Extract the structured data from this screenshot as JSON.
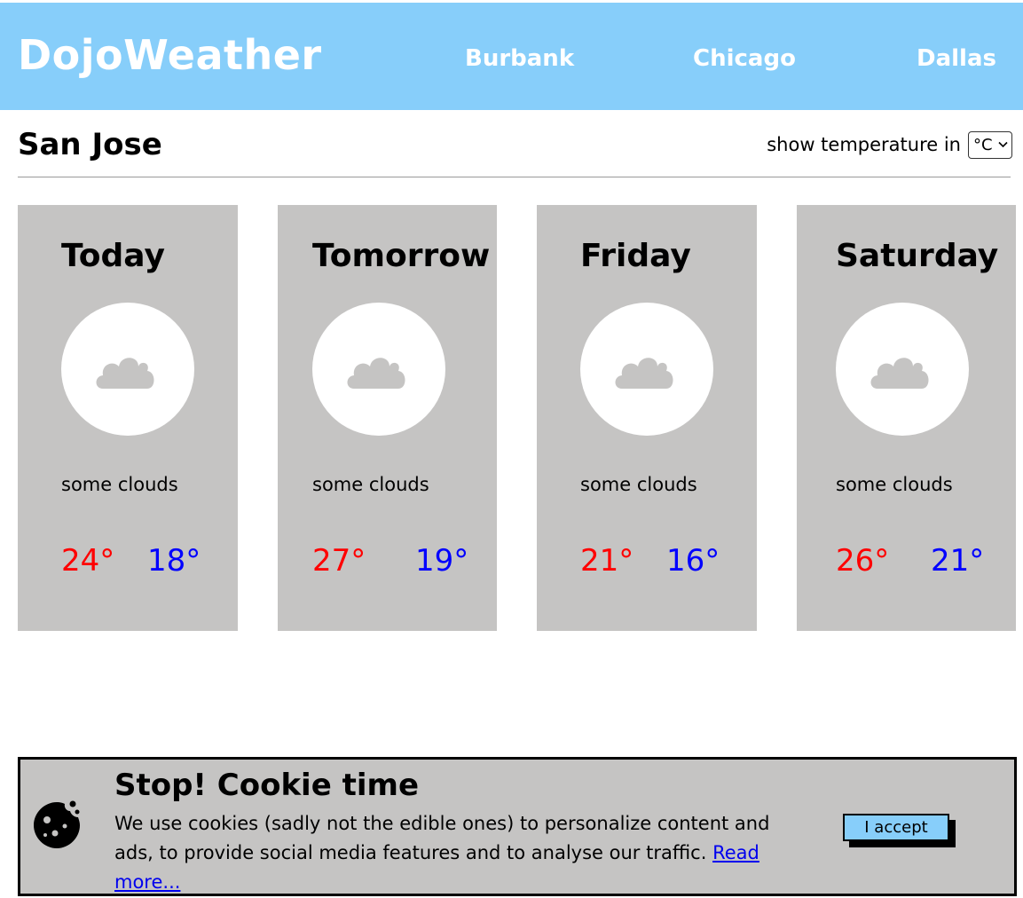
{
  "header": {
    "logo": "DojoWeather",
    "nav": [
      "Burbank",
      "Chicago",
      "Dallas"
    ],
    "background_color": "#87cefa"
  },
  "city": {
    "name": "San Jose",
    "unit_label": "show temperature in",
    "unit_selected": "°C"
  },
  "forecast": [
    {
      "day": "Today",
      "icon": "cloud-icon",
      "condition": "some clouds",
      "high": "24°",
      "low": "18°"
    },
    {
      "day": "Tomorrow",
      "icon": "cloud-icon",
      "condition": "some clouds",
      "high": "27°",
      "low": "19°"
    },
    {
      "day": "Friday",
      "icon": "cloud-icon",
      "condition": "some clouds",
      "high": "21°",
      "low": "16°"
    },
    {
      "day": "Saturday",
      "icon": "cloud-icon",
      "condition": "some clouds",
      "high": "26°",
      "low": "21°"
    }
  ],
  "colors": {
    "high_temp": "#ff0000",
    "low_temp": "#0000ff",
    "card_bg": "#c5c4c3"
  },
  "cookie": {
    "icon": "cookie-icon",
    "title": "Stop! Cookie time",
    "text": "We use cookies (sadly not the edible ones) to personalize content and ads, to provide social media features and to analyse our traffic.",
    "link": "Read more...",
    "accept": "I accept"
  }
}
